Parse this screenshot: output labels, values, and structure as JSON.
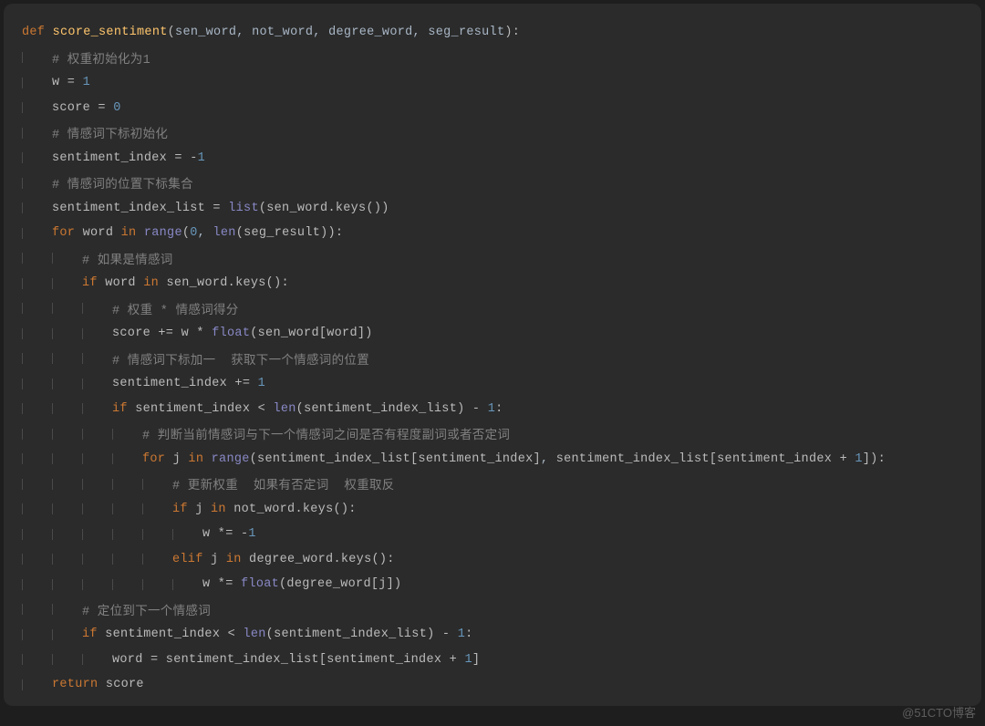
{
  "watermark": "@51CTO博客",
  "code": {
    "lines": [
      {
        "indent": 0,
        "tokens": [
          {
            "c": "kw",
            "t": "def "
          },
          {
            "c": "fn",
            "t": "score_sentiment"
          },
          {
            "c": "txt",
            "t": "("
          },
          {
            "c": "param",
            "t": "sen_word"
          },
          {
            "c": "op",
            "t": ", "
          },
          {
            "c": "param",
            "t": "not_word"
          },
          {
            "c": "op",
            "t": ", "
          },
          {
            "c": "param",
            "t": "degree_word"
          },
          {
            "c": "op",
            "t": ", "
          },
          {
            "c": "param",
            "t": "seg_result"
          },
          {
            "c": "txt",
            "t": "):"
          }
        ]
      },
      {
        "indent": 1,
        "tokens": [
          {
            "c": "cmt",
            "t": "# 权重初始化为1"
          }
        ]
      },
      {
        "indent": 1,
        "tokens": [
          {
            "c": "txt",
            "t": "w = "
          },
          {
            "c": "num",
            "t": "1"
          }
        ]
      },
      {
        "indent": 1,
        "tokens": [
          {
            "c": "txt",
            "t": "score = "
          },
          {
            "c": "num",
            "t": "0"
          }
        ]
      },
      {
        "indent": 1,
        "tokens": [
          {
            "c": "cmt",
            "t": "# 情感词下标初始化"
          }
        ]
      },
      {
        "indent": 1,
        "tokens": [
          {
            "c": "txt",
            "t": "sentiment_index = -"
          },
          {
            "c": "num",
            "t": "1"
          }
        ]
      },
      {
        "indent": 1,
        "tokens": [
          {
            "c": "cmt",
            "t": "# 情感词的位置下标集合"
          }
        ]
      },
      {
        "indent": 1,
        "tokens": [
          {
            "c": "txt",
            "t": "sentiment_index_list = "
          },
          {
            "c": "builtin",
            "t": "list"
          },
          {
            "c": "txt",
            "t": "(sen_word.keys())"
          }
        ]
      },
      {
        "indent": 1,
        "tokens": [
          {
            "c": "kw",
            "t": "for "
          },
          {
            "c": "txt",
            "t": "word "
          },
          {
            "c": "kw",
            "t": "in "
          },
          {
            "c": "builtin",
            "t": "range"
          },
          {
            "c": "txt",
            "t": "("
          },
          {
            "c": "num",
            "t": "0"
          },
          {
            "c": "op",
            "t": ", "
          },
          {
            "c": "builtin",
            "t": "len"
          },
          {
            "c": "txt",
            "t": "(seg_result)):"
          }
        ]
      },
      {
        "indent": 2,
        "tokens": [
          {
            "c": "cmt",
            "t": "# 如果是情感词"
          }
        ]
      },
      {
        "indent": 2,
        "tokens": [
          {
            "c": "kw",
            "t": "if "
          },
          {
            "c": "txt",
            "t": "word "
          },
          {
            "c": "kw",
            "t": "in "
          },
          {
            "c": "txt",
            "t": "sen_word.keys():"
          }
        ]
      },
      {
        "indent": 3,
        "tokens": [
          {
            "c": "cmt",
            "t": "# 权重 * 情感词得分"
          }
        ]
      },
      {
        "indent": 3,
        "tokens": [
          {
            "c": "txt",
            "t": "score += w * "
          },
          {
            "c": "builtin",
            "t": "float"
          },
          {
            "c": "txt",
            "t": "(sen_word[word])"
          }
        ]
      },
      {
        "indent": 3,
        "tokens": [
          {
            "c": "cmt",
            "t": "# 情感词下标加一  获取下一个情感词的位置"
          }
        ]
      },
      {
        "indent": 3,
        "tokens": [
          {
            "c": "txt",
            "t": "sentiment_index += "
          },
          {
            "c": "num",
            "t": "1"
          }
        ]
      },
      {
        "indent": 3,
        "tokens": [
          {
            "c": "kw",
            "t": "if "
          },
          {
            "c": "txt",
            "t": "sentiment_index < "
          },
          {
            "c": "builtin",
            "t": "len"
          },
          {
            "c": "txt",
            "t": "(sentiment_index_list) - "
          },
          {
            "c": "num",
            "t": "1"
          },
          {
            "c": "txt",
            "t": ":"
          }
        ]
      },
      {
        "indent": 4,
        "tokens": [
          {
            "c": "cmt",
            "t": "# 判断当前情感词与下一个情感词之间是否有程度副词或者否定词"
          }
        ]
      },
      {
        "indent": 4,
        "tokens": [
          {
            "c": "kw",
            "t": "for "
          },
          {
            "c": "txt",
            "t": "j "
          },
          {
            "c": "kw",
            "t": "in "
          },
          {
            "c": "builtin",
            "t": "range"
          },
          {
            "c": "txt",
            "t": "(sentiment_index_list[sentiment_index]"
          },
          {
            "c": "op",
            "t": ", "
          },
          {
            "c": "txt",
            "t": "sentiment_index_list[sentiment_index + "
          },
          {
            "c": "num",
            "t": "1"
          },
          {
            "c": "txt",
            "t": "]):"
          }
        ]
      },
      {
        "indent": 5,
        "tokens": [
          {
            "c": "cmt",
            "t": "# 更新权重  如果有否定词  权重取反"
          }
        ]
      },
      {
        "indent": 5,
        "tokens": [
          {
            "c": "kw",
            "t": "if "
          },
          {
            "c": "txt",
            "t": "j "
          },
          {
            "c": "kw",
            "t": "in "
          },
          {
            "c": "txt",
            "t": "not_word.keys():"
          }
        ]
      },
      {
        "indent": 6,
        "tokens": [
          {
            "c": "txt",
            "t": "w *= -"
          },
          {
            "c": "num",
            "t": "1"
          }
        ]
      },
      {
        "indent": 5,
        "tokens": [
          {
            "c": "kw",
            "t": "elif "
          },
          {
            "c": "txt",
            "t": "j "
          },
          {
            "c": "kw",
            "t": "in "
          },
          {
            "c": "txt",
            "t": "degree_word.keys():"
          }
        ]
      },
      {
        "indent": 6,
        "tokens": [
          {
            "c": "txt",
            "t": "w *= "
          },
          {
            "c": "builtin",
            "t": "float"
          },
          {
            "c": "txt",
            "t": "(degree_word[j])"
          }
        ]
      },
      {
        "indent": 2,
        "tokens": [
          {
            "c": "cmt",
            "t": "# 定位到下一个情感词"
          }
        ]
      },
      {
        "indent": 2,
        "tokens": [
          {
            "c": "kw",
            "t": "if "
          },
          {
            "c": "txt",
            "t": "sentiment_index < "
          },
          {
            "c": "builtin",
            "t": "len"
          },
          {
            "c": "txt",
            "t": "(sentiment_index_list) - "
          },
          {
            "c": "num",
            "t": "1"
          },
          {
            "c": "txt",
            "t": ":"
          }
        ]
      },
      {
        "indent": 3,
        "tokens": [
          {
            "c": "txt",
            "t": "word = sentiment_index_list[sentiment_index + "
          },
          {
            "c": "num",
            "t": "1"
          },
          {
            "c": "txt",
            "t": "]"
          }
        ]
      },
      {
        "indent": 1,
        "tokens": [
          {
            "c": "kw",
            "t": "return "
          },
          {
            "c": "txt",
            "t": "score"
          }
        ]
      }
    ]
  }
}
